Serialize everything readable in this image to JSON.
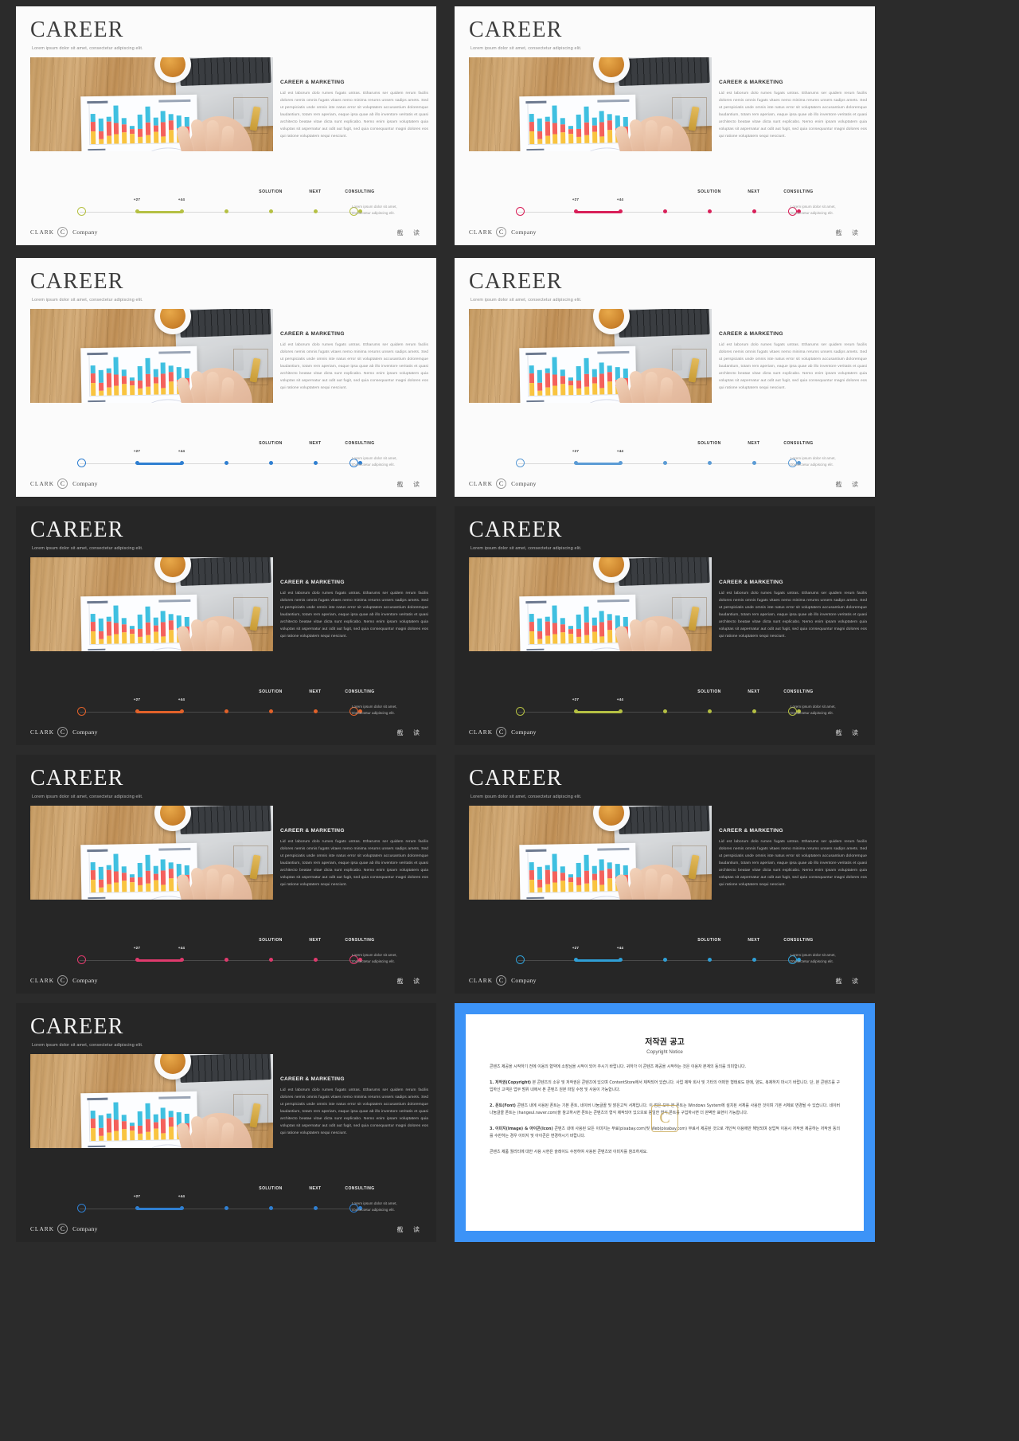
{
  "deck": {
    "title": "CAREER",
    "subtitle": "Lorem ipsum dolor sit amet, consectetur adipiscing  elit.",
    "section_heading": "CAREER & MARKETING",
    "body_text": "Lid est laborum dolo rumes fugats untras. Etharums ser quidem rerum facilis dolores nemis omnis fugats vitaes nemo minima rerums unsers sadips amets. Sed ut perspiciatis unde omnis iste natus error sit voluptatem accusantium doloremque laudantium, totam rem aperiam, eaque ipsa quae ab illo inventore veritatis et quasi architecto beatae vitae dicta sunt explicabo. Nemo enim ipsam voluptatem quia voluptas sit aspernatur aut odit aut fugit, sed quia consequuntur  magni dolores eos qui ratione voluptatem sequi nesciunt.",
    "timeline": {
      "markers": [
        "+27",
        "+44"
      ],
      "labels": [
        "SOLUTION",
        "NEXT",
        "CONSULTING"
      ],
      "note": "Lorem ipsum dolor sit amet, consectetur adipiscing elit."
    },
    "footer": {
      "brand": "CLARK",
      "mark": "C",
      "company": "Company"
    },
    "corner_mark": "截 读"
  },
  "slides": [
    {
      "id": 1,
      "theme": "light",
      "accent": "#b5c043",
      "row": 0,
      "col": 0
    },
    {
      "id": 2,
      "theme": "light",
      "accent": "#d81f58",
      "row": 0,
      "col": 1
    },
    {
      "id": 3,
      "theme": "light",
      "accent": "#2f7fd1",
      "row": 1,
      "col": 0
    },
    {
      "id": 4,
      "theme": "light",
      "accent": "#5b9bd5",
      "row": 1,
      "col": 1
    },
    {
      "id": 5,
      "theme": "dark",
      "accent": "#e2622a",
      "row": 2,
      "col": 0
    },
    {
      "id": 6,
      "theme": "dark",
      "accent": "#b5c043",
      "row": 2,
      "col": 1
    },
    {
      "id": 7,
      "theme": "dark",
      "accent": "#e03a6d",
      "row": 3,
      "col": 0
    },
    {
      "id": 8,
      "theme": "dark",
      "accent": "#2f9fd6",
      "row": 3,
      "col": 1
    },
    {
      "id": 9,
      "theme": "dark",
      "accent": "#2f7fd1",
      "row": 4,
      "col": 0
    }
  ],
  "copyright": {
    "title": "저작권 공고",
    "subtitle": "Copyright Notice",
    "intro": "콘텐츠 제공을 시작하기 전에 이용의 협약에 소장님을 시작이 되어 주시기 바랍니다. 귀하가 이 콘텐츠 제공을 시작하는 것은 이용자 본계의 동의를 의미합니다.",
    "p1_label": "1. 저작권(Copyright)",
    "p1": " 본 콘텐츠의 소유 및 저작권은 콘텐츠에 있으며 ContentStore에서 제작되어 있습니다. 사업 제작 회사 및 기타의 어떠한 형태로도 판매, 양도, 복제하지 마시기 바랍니다. 단, 본 콘텐츠를 구입하신 고객은 업무 범위 내에서 본 콘텐츠 원본 파일 수정 및 사용이 가능합니다.",
    "p2_label": "2. 폰트(Font)",
    "p2": " 콘텐츠 내에 사용된 폰트는 기본 폰트, 네이버 나눔글꼴 및 맑은고딕 서체입니다. 이 점은 모두 본 폰트는 Windows System에 설치된 서체를 사용한 것이며 기본 서체로 변경될 수 있습니다. 네이버 나눔글꼴 폰트는 (hangeul.naver.com)을 참고하시면 폰트는 콘텐츠의 형식 제작되어 있으므로 동일한 형식 폰트를 구입하시면 더 완벽한 표현이 가능합니다.",
    "p3_label": "3. 이미지(Image) & 아이콘(Icon)",
    "p3": " 콘텐츠 내에 사용된 모든 이미지는 무료(pixabay.com)및 Web(pixabay.com) 무료서 제공된 것으로 개인적 이용에만 해당되며 상업적 이용시 저작권 제공하는 저작권 동의를 수반하는 경우 이미지 및 아이콘은 변경하시기 바랍니다.",
    "outro": "콘텐츠 제품 퀄리티에 대한 사용 시현은 슬레이드 수정하여 사용된 콘텐츠와 이미지를 참조하세요."
  }
}
